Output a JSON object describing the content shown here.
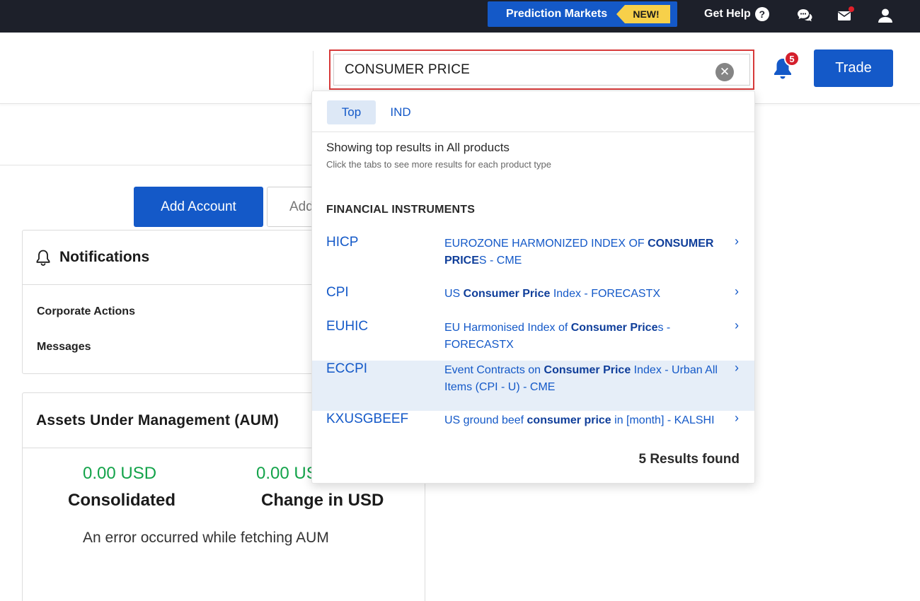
{
  "topbar": {
    "prediction_markets": "Prediction Markets",
    "new_badge": "NEW!",
    "get_help": "Get Help",
    "help_glyph": "?"
  },
  "search": {
    "value": "CONSUMER PRICE",
    "clear_glyph": "✕"
  },
  "notifications_badge": "5",
  "trade_label": "Trade",
  "account": {
    "add_account": "Add Account",
    "add_second_partial": "Add"
  },
  "notifications_card": {
    "title": "Notifications",
    "items": [
      "Corporate Actions",
      "Messages"
    ]
  },
  "aum": {
    "title": "Assets Under Management (AUM)",
    "consolidated_value": "0.00 USD",
    "consolidated_label": "Consolidated",
    "change_value": "0.00 USD",
    "change_label": "Change in USD",
    "error": "An error occurred while fetching AUM"
  },
  "dropdown": {
    "tabs": [
      {
        "label": "Top",
        "active": true
      },
      {
        "label": "IND",
        "active": false
      }
    ],
    "showing": "Showing top results in All products",
    "hint": "Click the tabs to see more results for each product type",
    "section_title": "FINANCIAL INSTRUMENTS",
    "results": [
      {
        "symbol": "HICP",
        "desc_parts": [
          [
            "EUROZONE HARMONIZED INDEX OF ",
            false
          ],
          [
            "CONSUMER PRICE",
            true
          ],
          [
            "S - CME",
            false
          ]
        ]
      },
      {
        "symbol": "CPI",
        "desc_parts": [
          [
            "US ",
            false
          ],
          [
            "Consumer Price",
            true
          ],
          [
            " Index - FORECASTX",
            false
          ]
        ]
      },
      {
        "symbol": "EUHIC",
        "desc_parts": [
          [
            "EU Harmonised Index of ",
            false
          ],
          [
            "Consumer Price",
            true
          ],
          [
            "s - FORECASTX",
            false
          ]
        ]
      },
      {
        "symbol": "ECCPI",
        "desc_parts": [
          [
            "Event Contracts on ",
            false
          ],
          [
            "Consumer Price",
            true
          ],
          [
            " Index - Urban All Items (CPI - U) - CME",
            false
          ]
        ]
      },
      {
        "symbol": "KXUSGBEEF",
        "desc_parts": [
          [
            "US ground beef ",
            false
          ],
          [
            "consumer price",
            true
          ],
          [
            " in [month] - KALSHI",
            false
          ]
        ]
      }
    ],
    "chevron_glyph": "›",
    "found_text": "5 Results found"
  }
}
